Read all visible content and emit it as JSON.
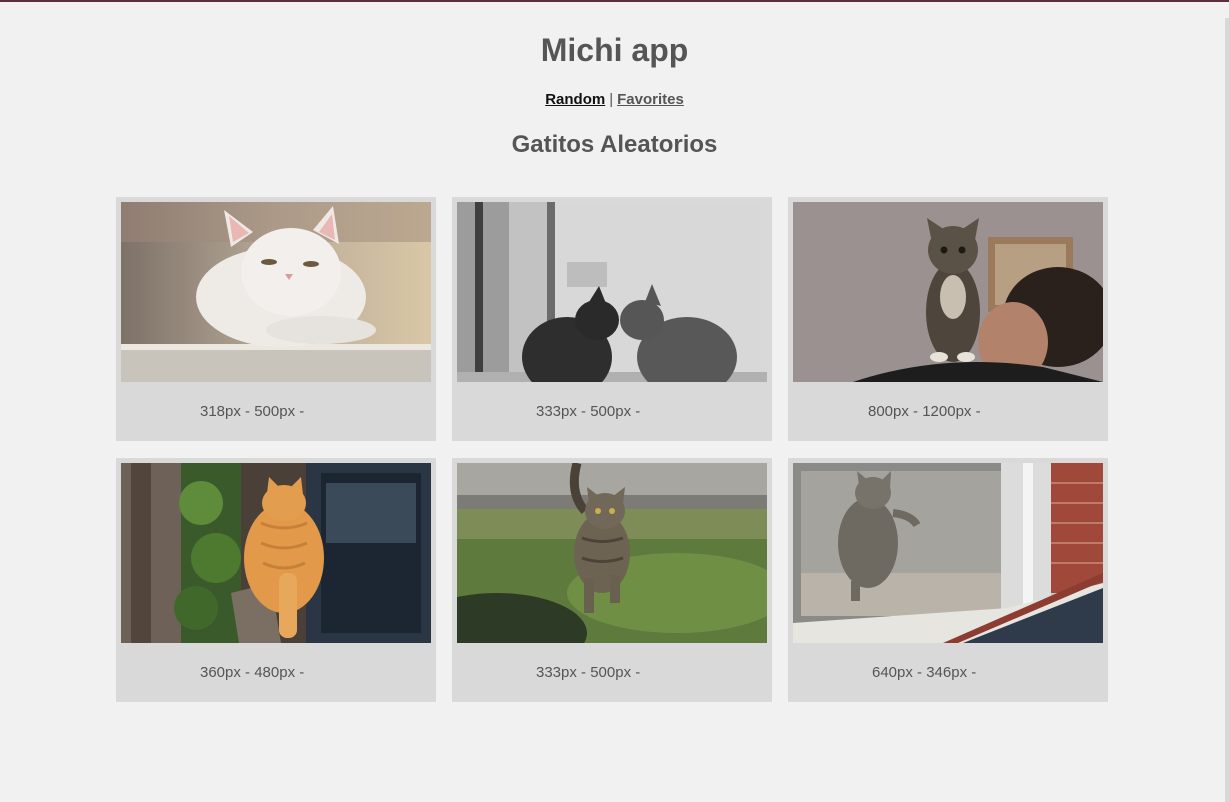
{
  "app": {
    "title": "Michi app"
  },
  "nav": {
    "random": "Random",
    "separator": "|",
    "favorites": "Favorites"
  },
  "section": {
    "title": "Gatitos Aleatorios"
  },
  "cards": [
    {
      "caption": "318px - 500px -",
      "photo": "white-cat-photo"
    },
    {
      "caption": "333px - 500px -",
      "photo": "two-cats-window-photo"
    },
    {
      "caption": "800px - 1200px -",
      "photo": "kitten-on-shoulder-photo"
    },
    {
      "caption": "360px - 480px -",
      "photo": "orange-cat-photo"
    },
    {
      "caption": "333px - 500px -",
      "photo": "tabby-cat-grass-photo"
    },
    {
      "caption": "640px - 346px -",
      "photo": "cat-at-door-photo"
    }
  ]
}
